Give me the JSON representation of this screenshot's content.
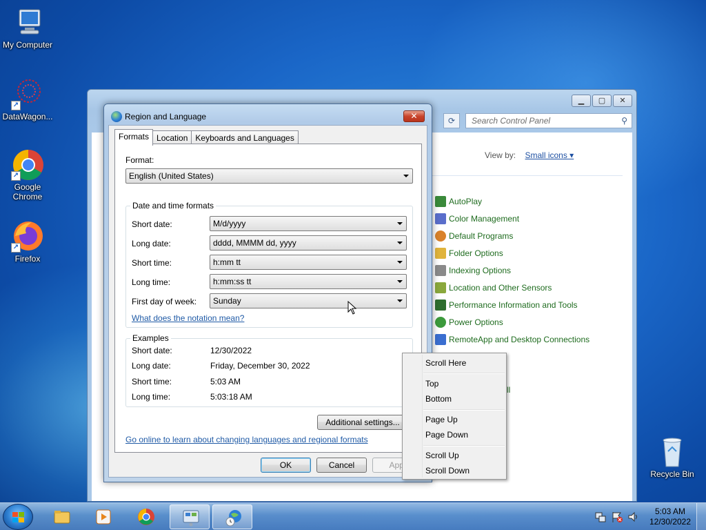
{
  "desktop": {
    "icons": [
      {
        "label": "My Computer"
      },
      {
        "label": "DataWagon..."
      },
      {
        "label": "Google Chrome"
      },
      {
        "label": "Firefox"
      },
      {
        "label": "Recycle Bin"
      }
    ]
  },
  "control_panel": {
    "search_placeholder": "Search Control Panel",
    "view_by_label": "View by:",
    "view_by_value": "Small icons ▾",
    "items": [
      {
        "label": "AutoPlay",
        "color": "#3a8a3a"
      },
      {
        "label": "Color Management",
        "color": "#5a6ecb"
      },
      {
        "label": "Default Programs",
        "color": "#d9822b"
      },
      {
        "label": "Folder Options",
        "color": "#e0b43c"
      },
      {
        "label": "Indexing Options",
        "color": "#8a8a8a"
      },
      {
        "label": "Location and Other Sensors",
        "color": "#8aa83c"
      },
      {
        "label": "Performance Information and Tools",
        "color": "#2e6e2e"
      },
      {
        "label": "Power Options",
        "color": "#3c9a3c"
      },
      {
        "label": "RemoteApp and Desktop Connections",
        "color": "#3a6ed0"
      }
    ],
    "fragment_text": "ll"
  },
  "dialog": {
    "title": "Region and Language",
    "close_glyph": "✕",
    "tabs": [
      {
        "label": "Formats"
      },
      {
        "label": "Location"
      },
      {
        "label": "Keyboards and Languages"
      }
    ],
    "format_label": "Format:",
    "format_value": "English (United States)",
    "dt_group_label": "Date and time formats",
    "fields": [
      {
        "label": "Short date:",
        "value": "M/d/yyyy"
      },
      {
        "label": "Long date:",
        "value": "dddd, MMMM dd, yyyy"
      },
      {
        "label": "Short time:",
        "value": "h:mm tt"
      },
      {
        "label": "Long time:",
        "value": "h:mm:ss tt"
      },
      {
        "label": "First day of week:",
        "value": "Sunday"
      }
    ],
    "notation_link": "What does the notation mean?",
    "examples_label": "Examples",
    "examples": [
      {
        "label": "Short date:",
        "value": "12/30/2022"
      },
      {
        "label": "Long date:",
        "value": "Friday, December 30, 2022"
      },
      {
        "label": "Short time:",
        "value": "5:03 AM"
      },
      {
        "label": "Long time:",
        "value": "5:03:18 AM"
      }
    ],
    "additional_settings": "Additional settings...",
    "online_link": "Go online to learn about changing languages and regional formats",
    "ok": "OK",
    "cancel": "Cancel",
    "apply": "Appl"
  },
  "context_menu": {
    "items": [
      "Scroll Here",
      "Top",
      "Bottom",
      "Page Up",
      "Page Down",
      "Scroll Up",
      "Scroll Down"
    ]
  },
  "taskbar": {
    "time": "5:03 AM",
    "date": "12/30/2022"
  }
}
